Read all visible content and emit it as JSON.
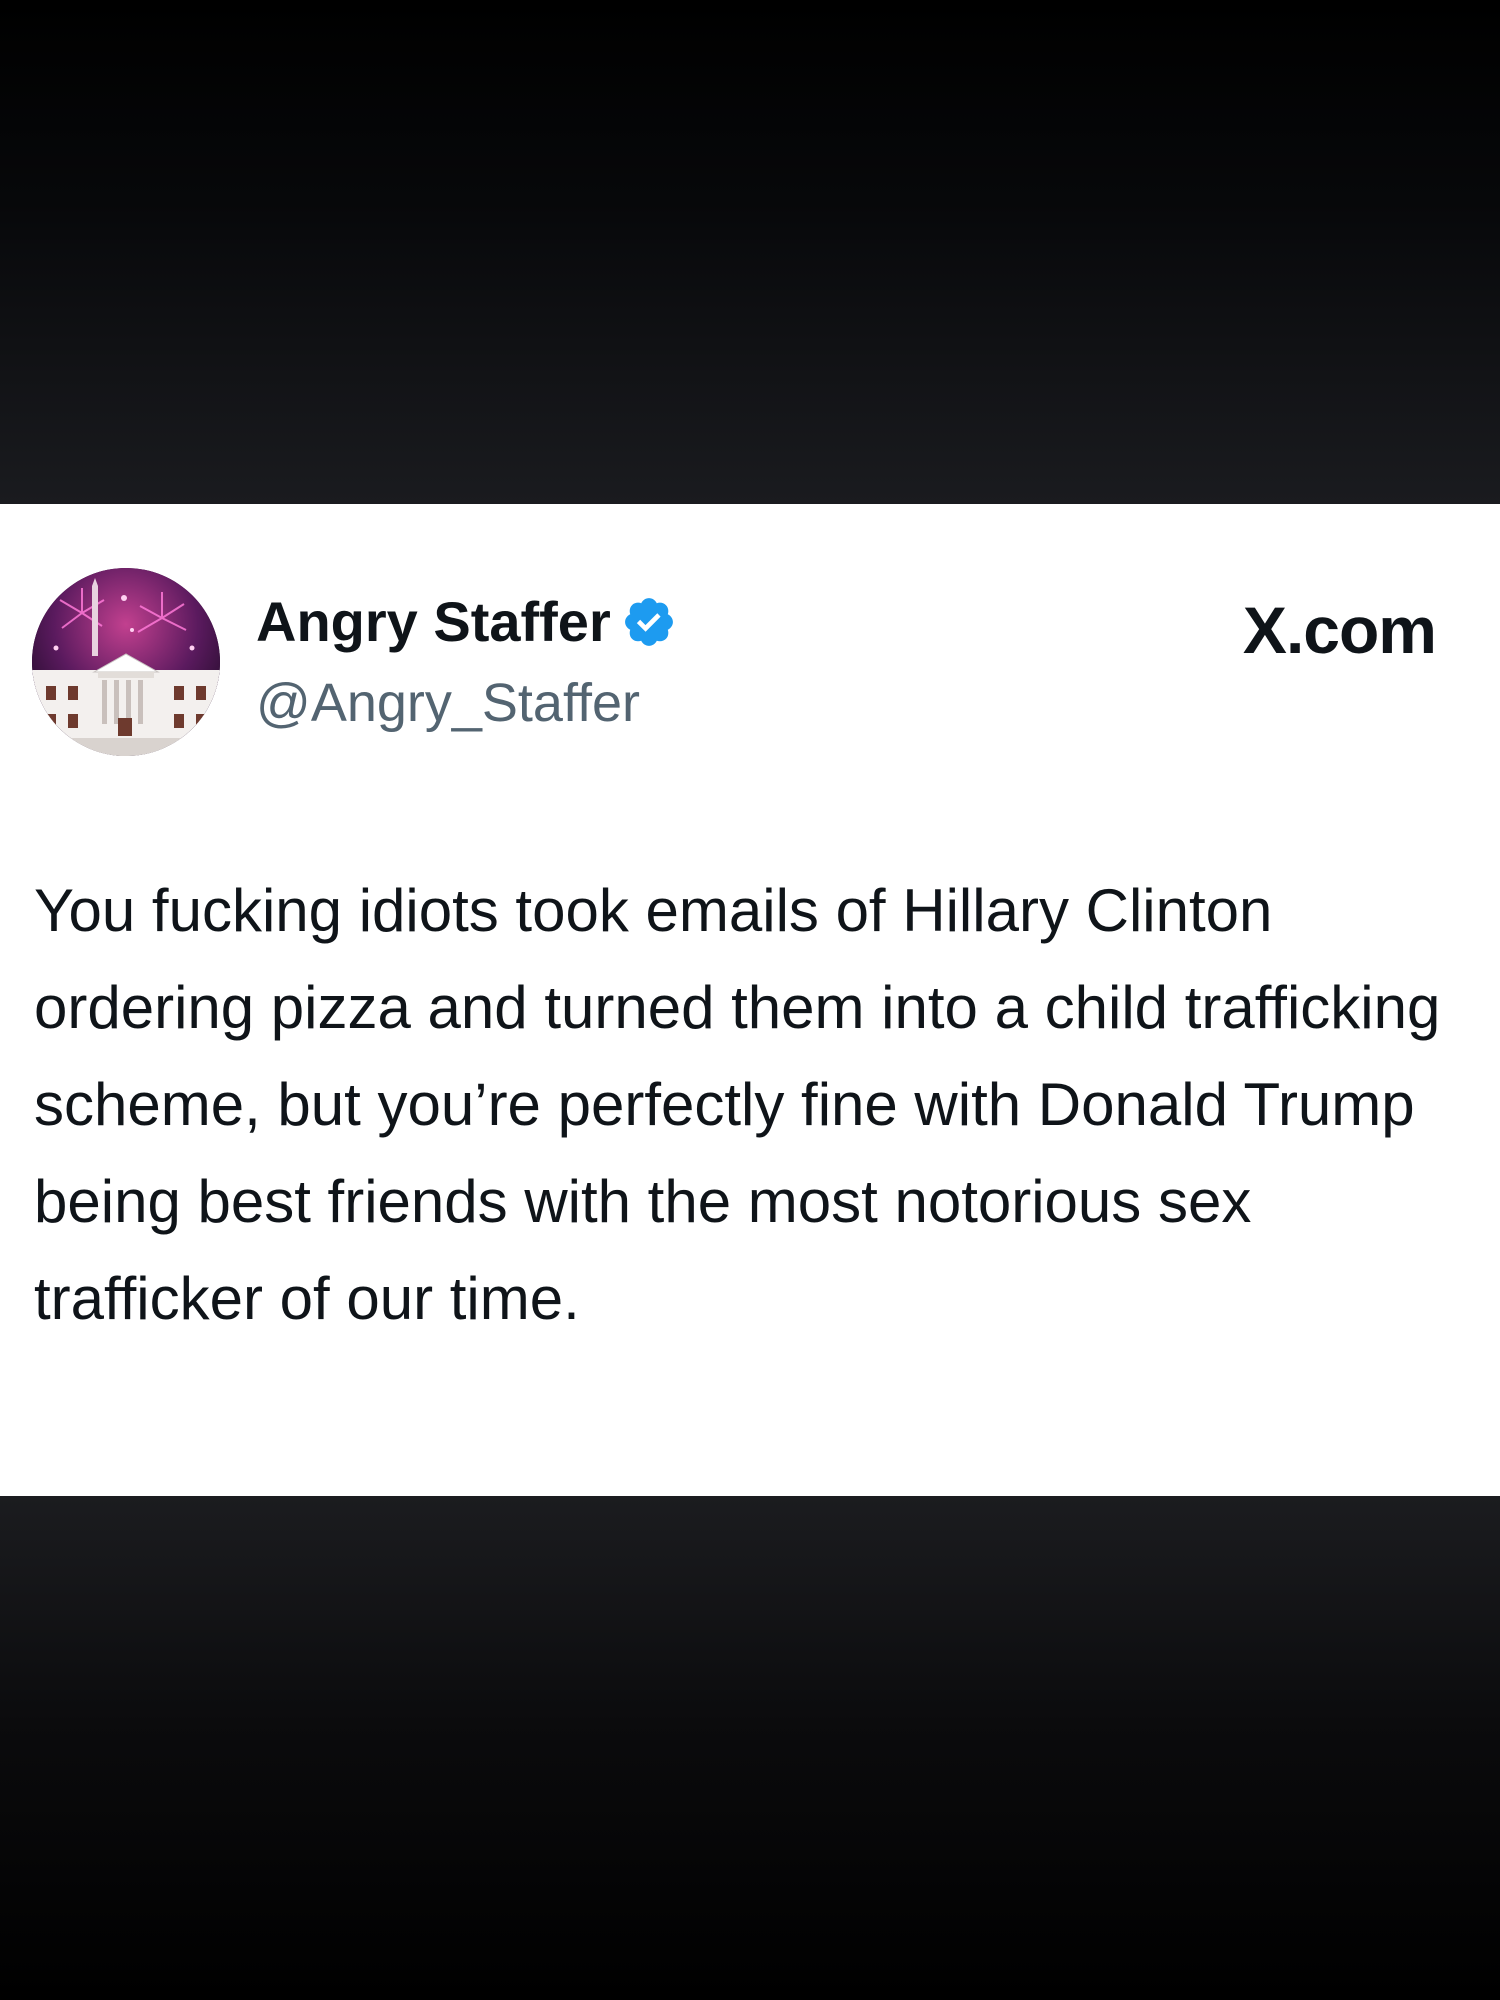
{
  "post": {
    "author": {
      "display_name": "Angry Staffer",
      "handle": "@Angry_Staffer",
      "verified": true,
      "avatar_icon": "white-house-fireworks-avatar"
    },
    "brand": "X.com",
    "text": "You fucking idiots took emails of Hillary Clinton ordering pizza and turned them into a child trafficking scheme, but you’re perfectly fine with Donald Trump being best friends with the most notorious sex trafficker of our time."
  },
  "colors": {
    "background": "#000000",
    "card": "#ffffff",
    "text_primary": "#0f1419",
    "text_secondary": "#536471",
    "verified_badge": "#1d9bf0"
  }
}
